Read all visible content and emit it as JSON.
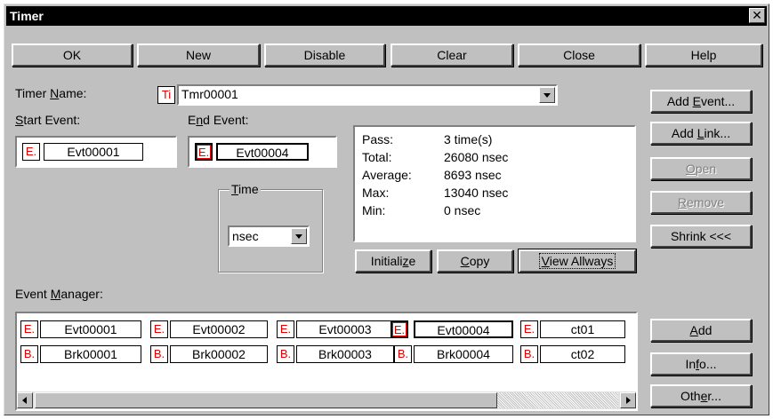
{
  "window": {
    "title": "Timer",
    "close_glyph": "✕"
  },
  "toolbar": {
    "ok": "OK",
    "new": "New",
    "disable": "Disable",
    "clear": "Clear",
    "close": "Close",
    "help": "Help"
  },
  "timer_name": {
    "label_pre": "Timer ",
    "label_u": "N",
    "label_post": "ame:",
    "icon_text": "Ti",
    "value": "Tmr00001"
  },
  "start_event": {
    "label_u": "S",
    "label_post": "tart Event:",
    "tag": "E.",
    "value": "Evt00001"
  },
  "end_event": {
    "label_pre": "E",
    "label_u": "n",
    "label_post": "d Event:",
    "tag": "E.",
    "value": "Evt00004"
  },
  "time": {
    "label_u": "T",
    "label_post": "ime",
    "unit": "nsec"
  },
  "stats": [
    {
      "key": "Pass:",
      "value": "3 time(s)"
    },
    {
      "key": "Total:",
      "value": "26080 nsec"
    },
    {
      "key": "Average:",
      "value": "8693 nsec"
    },
    {
      "key": "Max:",
      "value": "13040 nsec"
    },
    {
      "key": "Min:",
      "value": "0 nsec"
    }
  ],
  "actions": {
    "initialize_pre": "Initiali",
    "initialize_u": "z",
    "initialize_post": "e",
    "copy_u": "C",
    "copy_post": "opy",
    "view_u": "V",
    "view_post": "iew Allways"
  },
  "side": {
    "add_event_pre": "Add ",
    "add_event_u": "E",
    "add_event_post": "vent...",
    "add_link_pre": "Add ",
    "add_link_u": "L",
    "add_link_post": "ink...",
    "open_u": "O",
    "open_post": "pen",
    "remove_u": "R",
    "remove_post": "emove",
    "shrink": "Shrink <<<",
    "add_u": "A",
    "add_post": "dd",
    "info_pre": "In",
    "info_u": "f",
    "info_post": "o...",
    "other_pre": "Oth",
    "other_u": "e",
    "other_post": "r..."
  },
  "event_manager": {
    "label_pre": "Event ",
    "label_u": "M",
    "label_post": "anager:",
    "row1": [
      {
        "tag": "E.",
        "name": "Evt00001"
      },
      {
        "tag": "E.",
        "name": "Evt00002"
      },
      {
        "tag": "E.",
        "name": "Evt00003"
      },
      {
        "tag": "E.",
        "name": "Evt00004"
      },
      {
        "tag": "E.",
        "name": "ct01"
      }
    ],
    "row2": [
      {
        "tag": "B.",
        "name": "Brk00001"
      },
      {
        "tag": "B.",
        "name": "Brk00002"
      },
      {
        "tag": "B.",
        "name": "Brk00003"
      },
      {
        "tag": "B.",
        "name": "Brk00004"
      },
      {
        "tag": "B.",
        "name": "ct02"
      }
    ]
  }
}
